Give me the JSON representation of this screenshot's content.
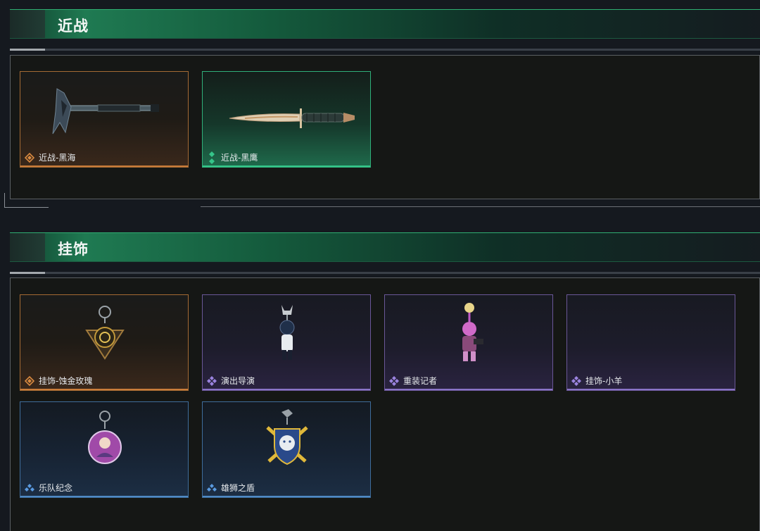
{
  "sections": [
    {
      "title": "近战",
      "items": [
        {
          "label": "近战-黑海",
          "rarity": "orange",
          "art": "axe-icon"
        },
        {
          "label": "近战-黑鹰",
          "rarity": "green",
          "art": "knife-icon"
        }
      ]
    },
    {
      "title": "挂饰",
      "items": [
        {
          "label": "挂饰-蚀金玫瑰",
          "rarity": "orange",
          "art": "rose-charm-icon"
        },
        {
          "label": "演出导演",
          "rarity": "purple",
          "art": "director-figure-icon"
        },
        {
          "label": "重装记者",
          "rarity": "purple",
          "art": "reporter-figure-icon"
        },
        {
          "label": "挂饰-小羊",
          "rarity": "purple",
          "art": "empty"
        },
        {
          "label": "乐队纪念",
          "rarity": "blue",
          "art": "band-badge-icon"
        },
        {
          "label": "雄狮之盾",
          "rarity": "blue",
          "art": "lion-shield-icon"
        }
      ]
    }
  ],
  "colors": {
    "orange": "#c97c3a",
    "green": "#35c58a",
    "purple": "#8a74c8",
    "blue": "#4f8ac4",
    "header": "#1f7a52"
  }
}
